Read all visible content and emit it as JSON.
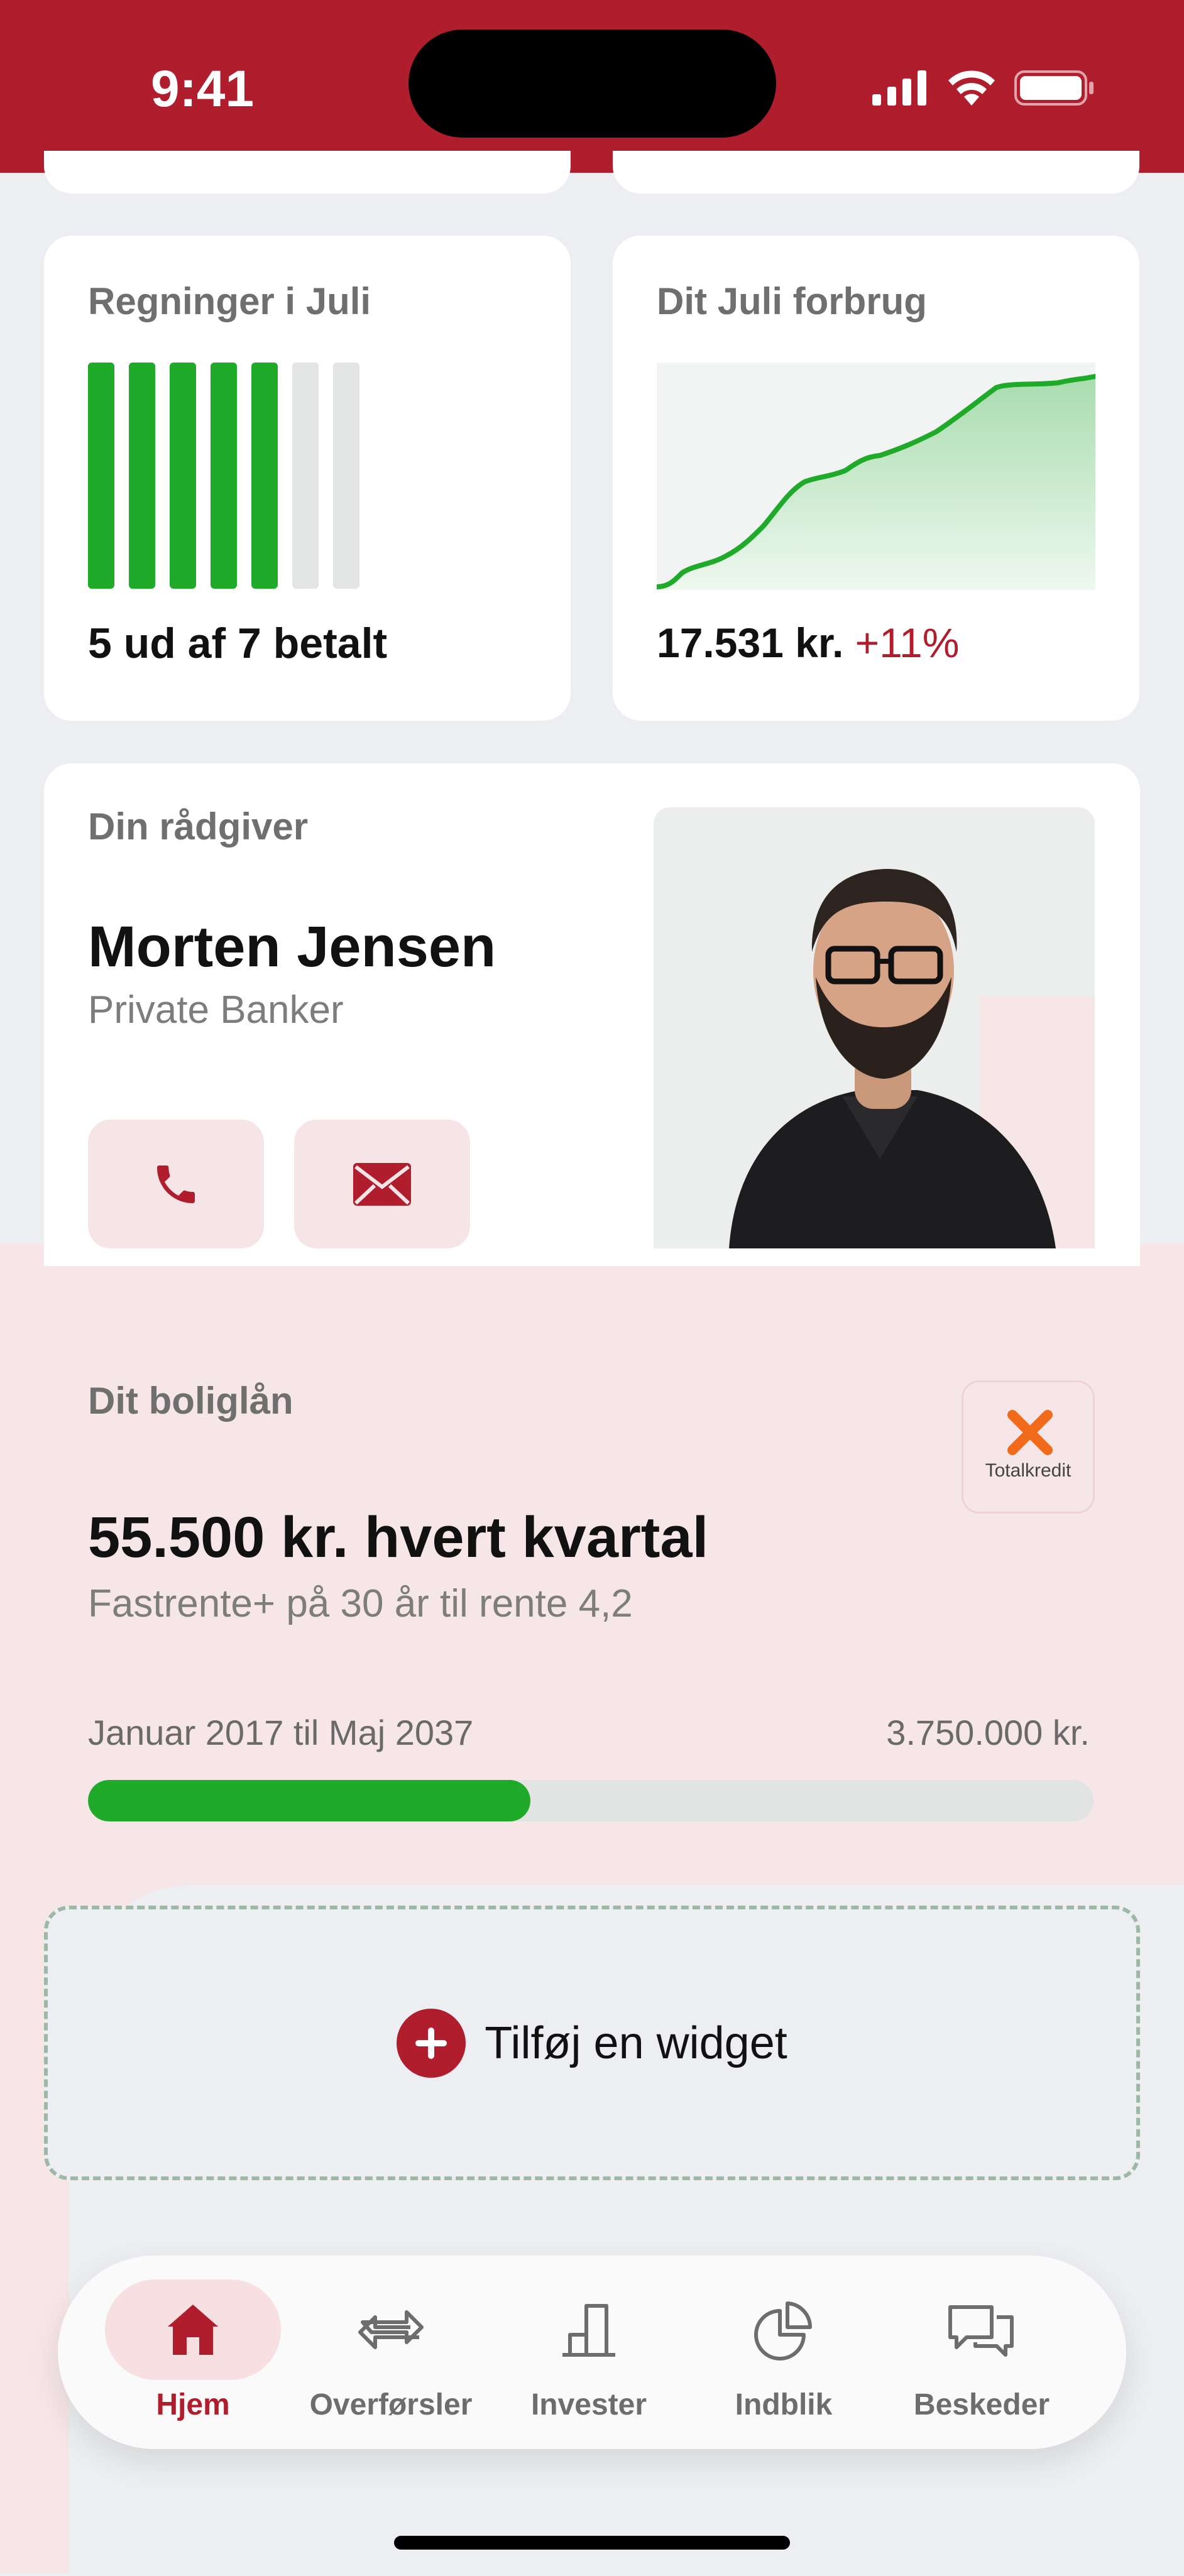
{
  "status_bar": {
    "time": "9:41"
  },
  "bills_card": {
    "title": "Regninger i Juli",
    "paid": 5,
    "total": 7,
    "summary": "5 ud af 7 betalt"
  },
  "spend_card": {
    "title": "Dit Juli forbrug",
    "amount": "17.531 kr.",
    "change": "+11%"
  },
  "advisor": {
    "title": "Din rådgiver",
    "name": "Morten Jensen",
    "role": "Private Banker"
  },
  "mortgage": {
    "title": "Dit boliglån",
    "amount": "55.500 kr. hvert kvartal",
    "description": "Fastrente+ på 30 år til rente 4,2",
    "period": "Januar 2017 til Maj 2037",
    "total": "3.750.000 kr.",
    "progress": 0.44,
    "lender": "Totalkredit"
  },
  "add_widget": {
    "label": "Tilføj en widget"
  },
  "tabbar": {
    "items": [
      {
        "label": "Hjem",
        "icon": "home-icon",
        "active": true
      },
      {
        "label": "Overførsler",
        "icon": "transfer-icon",
        "active": false
      },
      {
        "label": "Invester",
        "icon": "invest-icon",
        "active": false
      },
      {
        "label": "Indblik",
        "icon": "pie-chart-icon",
        "active": false
      },
      {
        "label": "Beskeder",
        "icon": "chat-icon",
        "active": false
      }
    ]
  },
  "colors": {
    "brand": "#b01e2d",
    "success": "#1faa2a",
    "track": "#e2e4e3",
    "soft_pink": "#f6e6e8"
  }
}
